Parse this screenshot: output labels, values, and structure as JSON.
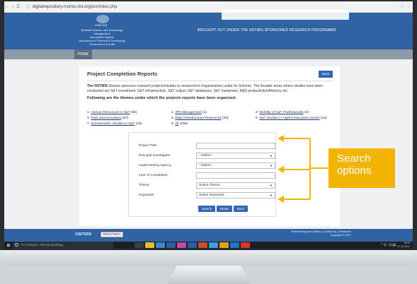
{
  "browser": {
    "url": "digitalrepository-nstmis-dst.org/pcr/index.php",
    "back_glyph": "←",
    "forward_glyph": "→",
    "reload_glyph": "C",
    "info_glyph": "ⓘ",
    "star_glyph": "☆",
    "menu_glyph": "⋮"
  },
  "header": {
    "org_lines": [
      "National Science and Technology Management",
      "Information System",
      "Department of Science & Technology",
      "Government of India"
    ],
    "emblem_caption": "सत्यमेव जयते",
    "tagline": "BROUGHT OUT UNDER THE NSTMIS SPONSORED RESEARCH PROGRAMME"
  },
  "menu": {
    "home": "HOME"
  },
  "content": {
    "title": "Project Completion Reports",
    "back_label": "Back",
    "intro_bold": "The NSTMIS",
    "intro_rest": " division sponsors research projects/studies to researchers /organizations under its Scheme. The broader areas where studies have been conducted are S&T investment, S&T infrastructure, S&T output, S&T databases, S&T manpower, R&D productivity/efficiency etc.",
    "themes_heading": "Following are the themes under which the projects reports have been organized:",
    "themes": [
      {
        "num": "1.",
        "name": "Human Resources in S&T",
        "count": "(56)"
      },
      {
        "num": "2.",
        "name": "IPR Management",
        "count": "(1)"
      },
      {
        "num": "3.",
        "name": "Mobility of S&T Professionals",
        "count": "(4)"
      },
      {
        "num": "4.",
        "name": "R&D and Innovation",
        "count": "(57)"
      },
      {
        "num": "5.",
        "name": "R&D Infrastructure/ Resources",
        "count": "(23)"
      },
      {
        "num": "6.",
        "name": "S&T Studies in Higher Education Sector",
        "count": "(13)"
      },
      {
        "num": "7.",
        "name": "Scientometric Studies in S&T",
        "count": "(19)"
      },
      {
        "num": "8.",
        "name": "All",
        "count": "(196)"
      }
    ]
  },
  "form": {
    "project_title_label": "Project Title",
    "project_title_value": "",
    "pi_label": "Principal Investigator",
    "pi_value": "--Select--",
    "agency_label": "Implementing Agency",
    "agency_value": "--Select--",
    "year_label": "Year of Completion",
    "year_value": "",
    "theme_label": "Theme",
    "theme_value": "Select Theme",
    "keywords_label": "Keywords",
    "keywords_value": "Select Keywords",
    "search_label": "Search",
    "reset_label": "Reset",
    "back_label": "Back",
    "caret": "▼"
  },
  "callout": {
    "text_line1": "Search",
    "text_line2": "options",
    "color": "#f3b400"
  },
  "footer": {
    "visitors_label": "VISITORS",
    "visitors_count": "0002276931",
    "links": "Referencing and Citation | Contact Us | Disclaimer",
    "copyright": "Copyright © 2017"
  },
  "taskbar": {
    "windows_glyph": "⊞",
    "search_placeholder": "I'm Cortana. Ask me anything.",
    "time": "13:22",
    "date": "17-11-2017",
    "tray_glyphs": "^ ⊡ ◁) ▤"
  }
}
